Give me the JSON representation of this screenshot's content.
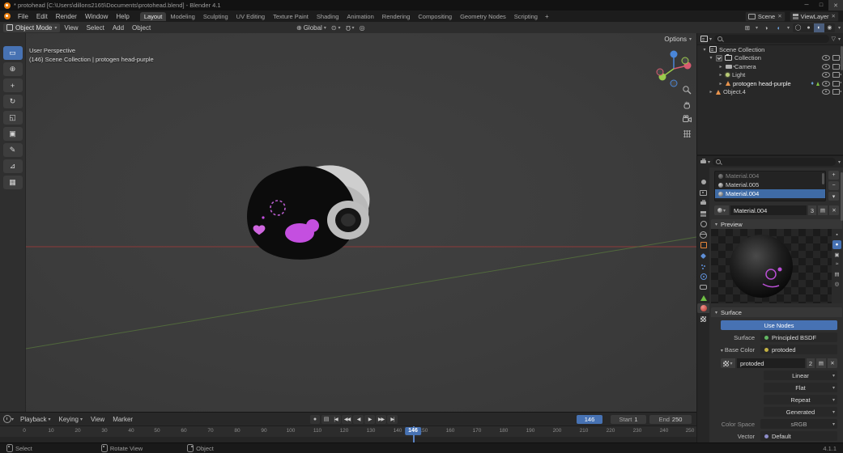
{
  "icons": {
    "chevron_down": "▾",
    "chevron_right": "▸",
    "plus": "+",
    "minus": "−",
    "close": "✕",
    "minimize": "─",
    "maximize": "□",
    "filter": "▽",
    "diamond": "♦",
    "orientation": "⊕",
    "pivot": "⊙",
    "snap": "Ω",
    "prop_edit": "◎",
    "grid": "⊞",
    "overlay_a": "◑",
    "overlay_b": "◐",
    "record": "●",
    "stack": "▤"
  },
  "titlebar": {
    "title": "* protohead [C:\\Users\\dillons2165\\Documents\\protohead.blend] - Blender 4.1"
  },
  "menubar": {
    "menus": [
      "File",
      "Edit",
      "Render",
      "Window",
      "Help"
    ],
    "workspaces": [
      "Layout",
      "Modeling",
      "Sculpting",
      "UV Editing",
      "Texture Paint",
      "Shading",
      "Animation",
      "Rendering",
      "Compositing",
      "Geometry Nodes",
      "Scripting"
    ],
    "active_workspace": "Layout",
    "add_tab": "+",
    "scene": "Scene",
    "viewlayer": "ViewLayer"
  },
  "tool_header": {
    "mode": "Object Mode",
    "menus": [
      "View",
      "Select",
      "Add",
      "Object"
    ],
    "orientation": "Global",
    "options": "Options",
    "shading": [
      "◯",
      "●",
      "◐",
      "◉"
    ]
  },
  "toolbar": {
    "tools": [
      {
        "name": "select-box",
        "glyph": "▭"
      },
      {
        "name": "cursor",
        "glyph": "⊕"
      },
      {
        "name": "move",
        "glyph": "+"
      },
      {
        "name": "rotate",
        "glyph": "↻"
      },
      {
        "name": "scale",
        "glyph": "◱"
      },
      {
        "name": "transform",
        "glyph": "▣"
      },
      {
        "name": "annotate",
        "glyph": "✎"
      },
      {
        "name": "measure",
        "glyph": "⊿"
      },
      {
        "name": "add-cube",
        "glyph": "▦"
      }
    ]
  },
  "viewport": {
    "view_label": "User Perspective",
    "context_label": "(146) Scene Collection | protogen head-purple"
  },
  "outliner": {
    "rows": [
      {
        "label": "Scene Collection"
      },
      {
        "label": "Collection"
      },
      {
        "label": "Camera"
      },
      {
        "label": "Light"
      },
      {
        "label": "protogen head-purple"
      },
      {
        "label": "Object.4"
      }
    ]
  },
  "properties": {
    "slots": [
      {
        "name": "Material.004"
      },
      {
        "name": "Material.005"
      },
      {
        "name": "Material.004"
      }
    ],
    "datablock": {
      "name": "Material.004",
      "users": "3"
    },
    "preview_header": "Preview",
    "preview_types": [
      "▪",
      "●",
      "▣",
      "≈",
      "▤",
      "◎"
    ],
    "surface_header": "Surface",
    "use_nodes": "Use Nodes",
    "surface_label": "Surface",
    "surface_value": "Principled BSDF",
    "base_color_label": "Base Color",
    "base_color_value": "protoded",
    "image": {
      "name": "protoded",
      "users": "2"
    },
    "interpolation": "Linear",
    "projection": "Flat",
    "extension": "Repeat",
    "source": "Generated",
    "color_space_label": "Color Space",
    "color_space_value": "sRGB",
    "vector_label": "Vector",
    "vector_value": "Default"
  },
  "timeline": {
    "menus": [
      "Playback",
      "Keying",
      "View",
      "Marker"
    ],
    "playback": [
      "|◀",
      "◀◀",
      "◀",
      "▶",
      "▶▶",
      "▶|"
    ],
    "ticks": [
      "0",
      "10",
      "20",
      "30",
      "40",
      "50",
      "60",
      "70",
      "80",
      "90",
      "100",
      "110",
      "120",
      "130",
      "140",
      "150",
      "160",
      "170",
      "180",
      "190",
      "200",
      "210",
      "220",
      "230",
      "240",
      "250"
    ],
    "current_frame": "146",
    "start_label": "Start",
    "start_value": "1",
    "end_label": "End",
    "end_value": "250"
  },
  "statusbar": {
    "select": "Select",
    "rotate": "Rotate View",
    "object": "Object",
    "version": "4.1.1"
  },
  "colors": {
    "accent": "#4772b3",
    "axis_x": "#7e3b3b",
    "axis_y": "#55713d",
    "object_orange": "#e8863a",
    "material_purple": "#c44fe0"
  }
}
